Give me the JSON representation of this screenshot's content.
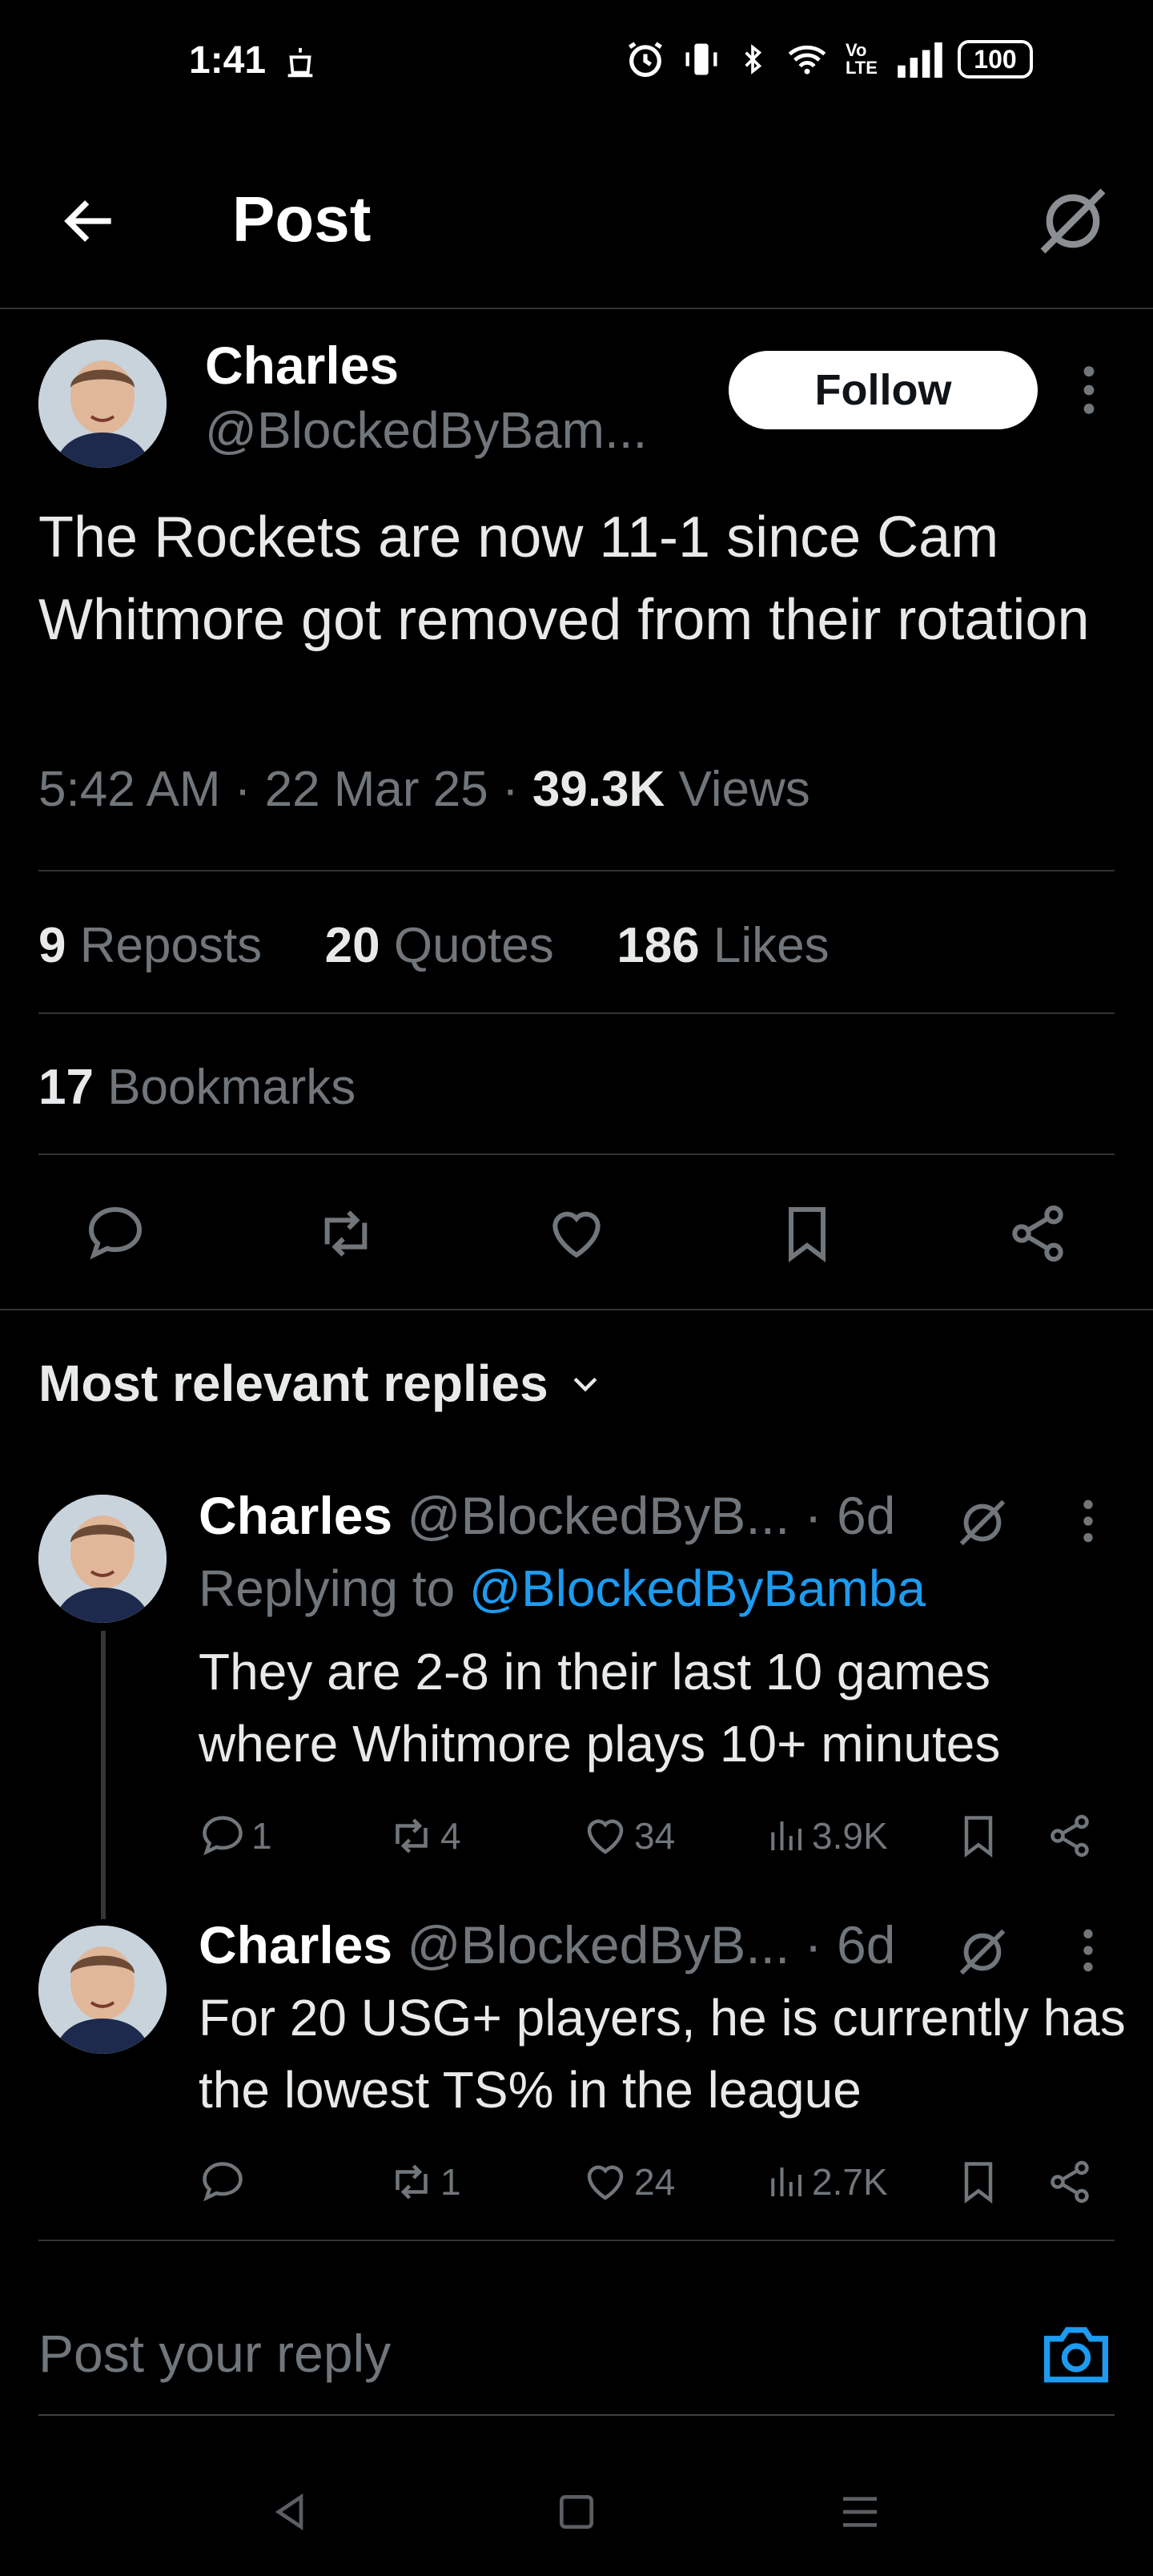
{
  "status_bar": {
    "time": "1:41",
    "battery": "100",
    "net": "Vo LTE"
  },
  "topbar": {
    "title": "Post"
  },
  "tweet": {
    "author_name": "Charles",
    "author_handle": "@BlockedByBam...",
    "follow_label": "Follow",
    "text": "The Rockets are now 11-1 since Cam Whitmore got removed from their rotation",
    "time": "5:42 AM",
    "date": "22 Mar 25",
    "views_count": "39.3K",
    "views_label": "Views",
    "reposts_count": "9",
    "reposts_label": "Reposts",
    "quotes_count": "20",
    "quotes_label": "Quotes",
    "likes_count": "186",
    "likes_label": "Likes",
    "bookmarks_count": "17",
    "bookmarks_label": "Bookmarks"
  },
  "replies_section": {
    "sort_label": "Most relevant replies"
  },
  "replies": [
    {
      "name": "Charles",
      "handle": "@BlockedByB...",
      "age": "· 6d",
      "replying_prefix": "Replying to",
      "replying_to": "@BlockedByBamba",
      "text": "They are 2-8 in their last 10 games where Whitmore plays 10+ minutes",
      "replies": "1",
      "reposts": "4",
      "likes": "34",
      "views": "3.9K"
    },
    {
      "name": "Charles",
      "handle": "@BlockedByB...",
      "age": "· 6d",
      "text": "For 20 USG+ players, he is currently has the lowest TS% in the league",
      "replies": "",
      "reposts": "1",
      "likes": "24",
      "views": "2.7K"
    }
  ],
  "composer": {
    "placeholder": "Post your reply"
  },
  "colors": {
    "background": "#000000",
    "text": "#e7e9ea",
    "muted": "#71767b",
    "link": "#1d9bf0",
    "divider": "#2f3336"
  }
}
